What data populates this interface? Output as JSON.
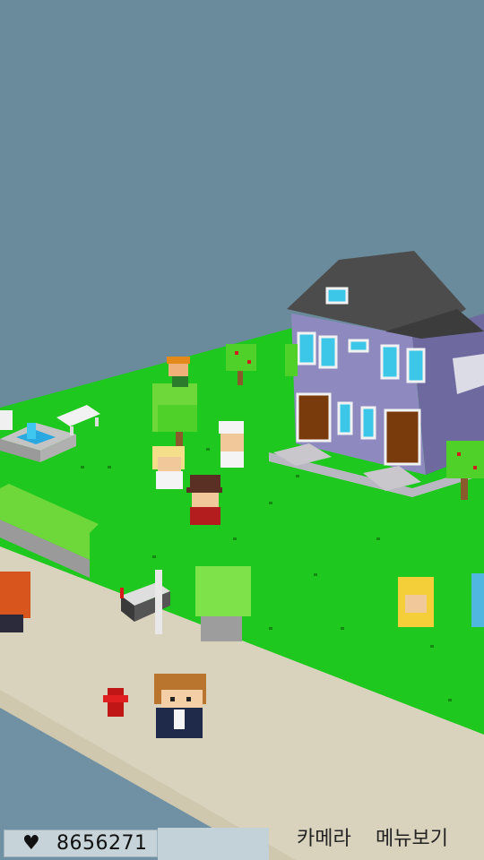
{
  "hud": {
    "heart_icon": "♥",
    "heart_count": "8656271",
    "camera_label": "카메라",
    "menu_label": "메뉴보기"
  },
  "colors": {
    "sky": "#6a8b9c",
    "grass": "#1fc61f",
    "sidewalk": "#d8d2bd",
    "road": "#6d8fa1",
    "house_wall": "#8d88bd",
    "roof": "#4d4d4d"
  },
  "icons": [
    "heart-icon"
  ]
}
